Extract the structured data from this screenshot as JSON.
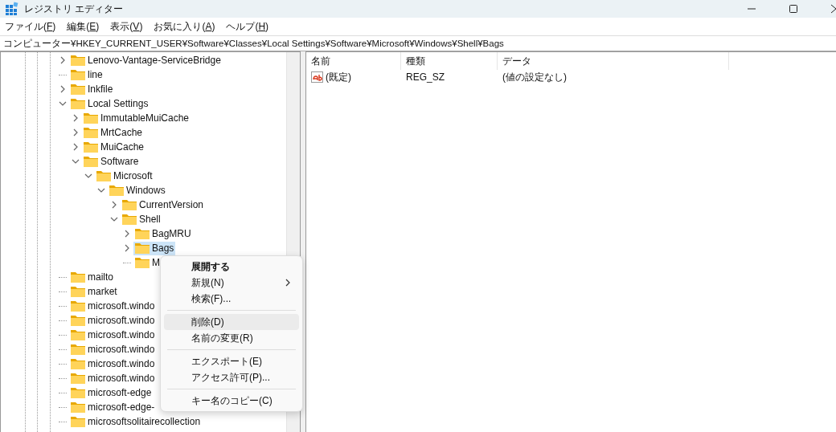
{
  "window": {
    "title": "レジストリ エディター"
  },
  "menu_bar": [
    {
      "before": "ファイル(",
      "key": "F",
      "after": ")"
    },
    {
      "before": "編集(",
      "key": "E",
      "after": ")"
    },
    {
      "before": "表示(",
      "key": "V",
      "after": ")"
    },
    {
      "before": "お気に入り(",
      "key": "A",
      "after": ")"
    },
    {
      "before": "ヘルプ(",
      "key": "H",
      "after": ")"
    }
  ],
  "address_bar": "コンピューター¥HKEY_CURRENT_USER¥Software¥Classes¥Local Settings¥Software¥Microsoft¥Windows¥Shell¥Bags",
  "tree": [
    {
      "label": "Lenovo-Vantage-ServiceBridge",
      "expanded": false,
      "selected": false
    },
    {
      "label": "line",
      "selected": false
    },
    {
      "label": "Inkfile",
      "expanded": false,
      "selected": false
    },
    {
      "label": "Local Settings",
      "expanded": true,
      "selected": false,
      "children": [
        {
          "label": "ImmutableMuiCache",
          "expanded": false,
          "selected": false
        },
        {
          "label": "MrtCache",
          "expanded": false,
          "selected": false
        },
        {
          "label": "MuiCache",
          "expanded": false,
          "selected": false
        },
        {
          "label": "Software",
          "expanded": true,
          "selected": false,
          "children": [
            {
              "label": "Microsoft",
              "expanded": true,
              "selected": false,
              "children": [
                {
                  "label": "Windows",
                  "expanded": true,
                  "selected": false,
                  "children": [
                    {
                      "label": "CurrentVersion",
                      "expanded": false,
                      "selected": false
                    },
                    {
                      "label": "Shell",
                      "expanded": true,
                      "selected": false,
                      "children": [
                        {
                          "label": "BagMRU",
                          "expanded": false,
                          "selected": false
                        },
                        {
                          "label": "Bags",
                          "expanded": false,
                          "selected": true
                        },
                        {
                          "label": "M",
                          "selected": false
                        }
                      ]
                    }
                  ]
                }
              ]
            }
          ]
        }
      ]
    },
    {
      "label": "mailto",
      "selected": false
    },
    {
      "label": "market",
      "selected": false
    },
    {
      "label": "microsoft.windo",
      "selected": false
    },
    {
      "label": "microsoft.windo",
      "selected": false
    },
    {
      "label": "microsoft.windo",
      "selected": false
    },
    {
      "label": "microsoft.windo",
      "selected": false
    },
    {
      "label": "microsoft.windo",
      "selected": false
    },
    {
      "label": "microsoft.windo",
      "selected": false
    },
    {
      "label": "microsoft-edge",
      "selected": false
    },
    {
      "label": "microsoft-edge-",
      "selected": false
    },
    {
      "label": "microsoftsolitairecollection",
      "selected": false
    }
  ],
  "list": {
    "columns": [
      "名前",
      "種類",
      "データ"
    ],
    "rows": [
      {
        "name": "(既定)",
        "type": "REG_SZ",
        "data": "(値の設定なし)"
      }
    ]
  },
  "context_menu": [
    {
      "kind": "item",
      "label": "展開する",
      "default": true,
      "submenu": false,
      "highlighted": false
    },
    {
      "kind": "item",
      "label": "新規(N)",
      "default": false,
      "submenu": true,
      "highlighted": false
    },
    {
      "kind": "item",
      "label": "検索(F)...",
      "default": false,
      "submenu": false,
      "highlighted": false
    },
    {
      "kind": "separator"
    },
    {
      "kind": "item",
      "label": "削除(D)",
      "default": false,
      "submenu": false,
      "highlighted": true
    },
    {
      "kind": "item",
      "label": "名前の変更(R)",
      "default": false,
      "submenu": false,
      "highlighted": false
    },
    {
      "kind": "separator"
    },
    {
      "kind": "item",
      "label": "エクスポート(E)",
      "default": false,
      "submenu": false,
      "highlighted": false
    },
    {
      "kind": "item",
      "label": "アクセス許可(P)...",
      "default": false,
      "submenu": false,
      "highlighted": false
    },
    {
      "kind": "separator"
    },
    {
      "kind": "item",
      "label": "キー名のコピー(C)",
      "default": false,
      "submenu": false,
      "highlighted": false
    }
  ]
}
